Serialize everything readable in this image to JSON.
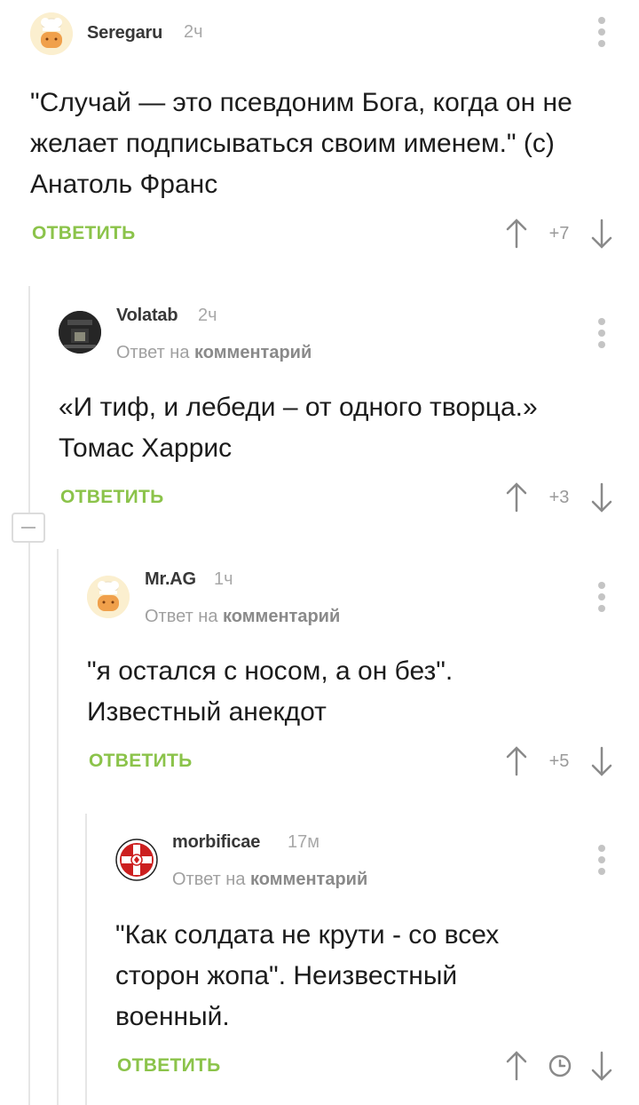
{
  "comments": [
    {
      "author": "Seregaru",
      "time": "2ч",
      "reply_to": null,
      "text_lines": [
        "\"Случай — это псевдоним Бога, когда он не",
        "желает подписываться своим именем.\" (с)",
        "Анатоль Франс"
      ],
      "answer": "ОТВЕТИТЬ",
      "rating": "+7",
      "avatar": "chef-avatar"
    },
    {
      "author": "Volatab",
      "time": "2ч",
      "reply_to": {
        "prefix": "Ответ на",
        "link": "комментарий"
      },
      "text_lines": [
        "«И тиф, и лебеди – от одного творца.»",
        "Томас Харрис"
      ],
      "answer": "ОТВЕТИТЬ",
      "rating": "+3",
      "avatar": "dark-photo-avatar"
    },
    {
      "author": "Mr.AG",
      "time": "1ч",
      "reply_to": {
        "prefix": "Ответ на",
        "link": "комментарий"
      },
      "text_lines": [
        "\"я остался с носом, а он без\".",
        "Известный анекдот"
      ],
      "answer": "ОТВЕТИТЬ",
      "rating": "+5",
      "avatar": "chef-avatar"
    },
    {
      "author": "morbificae",
      "time": "17м",
      "reply_to": {
        "prefix": "Ответ на",
        "link": "комментарий"
      },
      "text_lines": [
        "\"Как солдата не крути - со всех",
        "сторон жопа\". Неизвестный",
        "военный."
      ],
      "answer": "ОТВЕТИТЬ",
      "rating": null,
      "avatar": "red-cross-emblem-avatar"
    }
  ],
  "colors": {
    "accent": "#8bc34a",
    "muted": "#a8a8a8",
    "line": "#e6e6e6"
  }
}
